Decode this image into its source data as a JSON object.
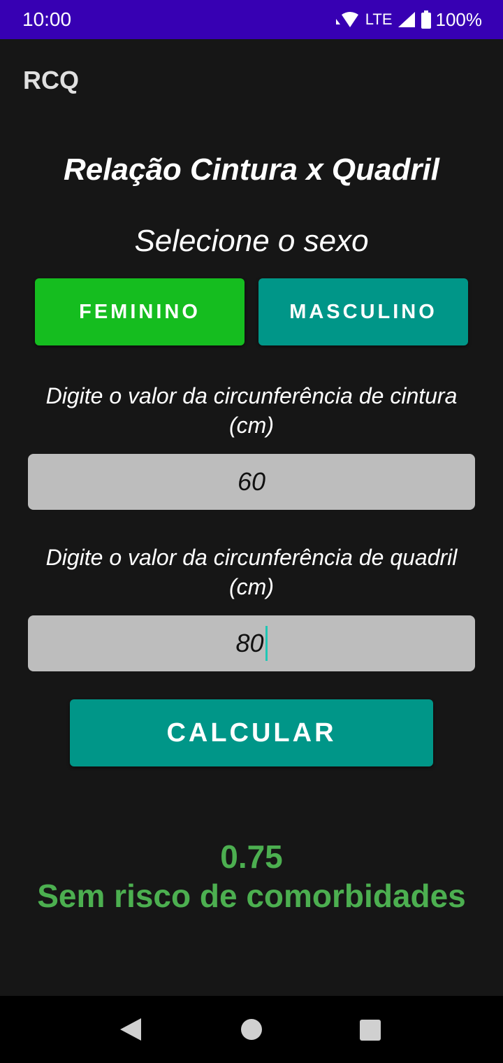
{
  "status_bar": {
    "time": "10:00",
    "network": "LTE",
    "battery": "100%",
    "icons": [
      "wifi-icon",
      "signal-icon",
      "battery-icon"
    ]
  },
  "app_bar": {
    "title": "RCQ"
  },
  "main": {
    "heading": "Relação Cintura x Quadril",
    "sex_prompt": "Selecione o sexo",
    "buttons": {
      "feminino": "FEMININO",
      "masculino": "MASCULINO",
      "calcular": "CALCULAR"
    },
    "cintura": {
      "label": "Digite o valor da circunferência de cintura (cm)",
      "value": "60"
    },
    "quadril": {
      "label": "Digite o valor da circunferência de quadril (cm)",
      "value": "80"
    },
    "result": {
      "value": "0.75",
      "text": "Sem risco de comorbidades"
    }
  },
  "colors": {
    "status_bar": "#3700b3",
    "background": "#161616",
    "feminino_button": "#15bd1f",
    "primary_button": "#009688",
    "input_background": "#bdbdbd",
    "result_text": "#4caf50"
  }
}
